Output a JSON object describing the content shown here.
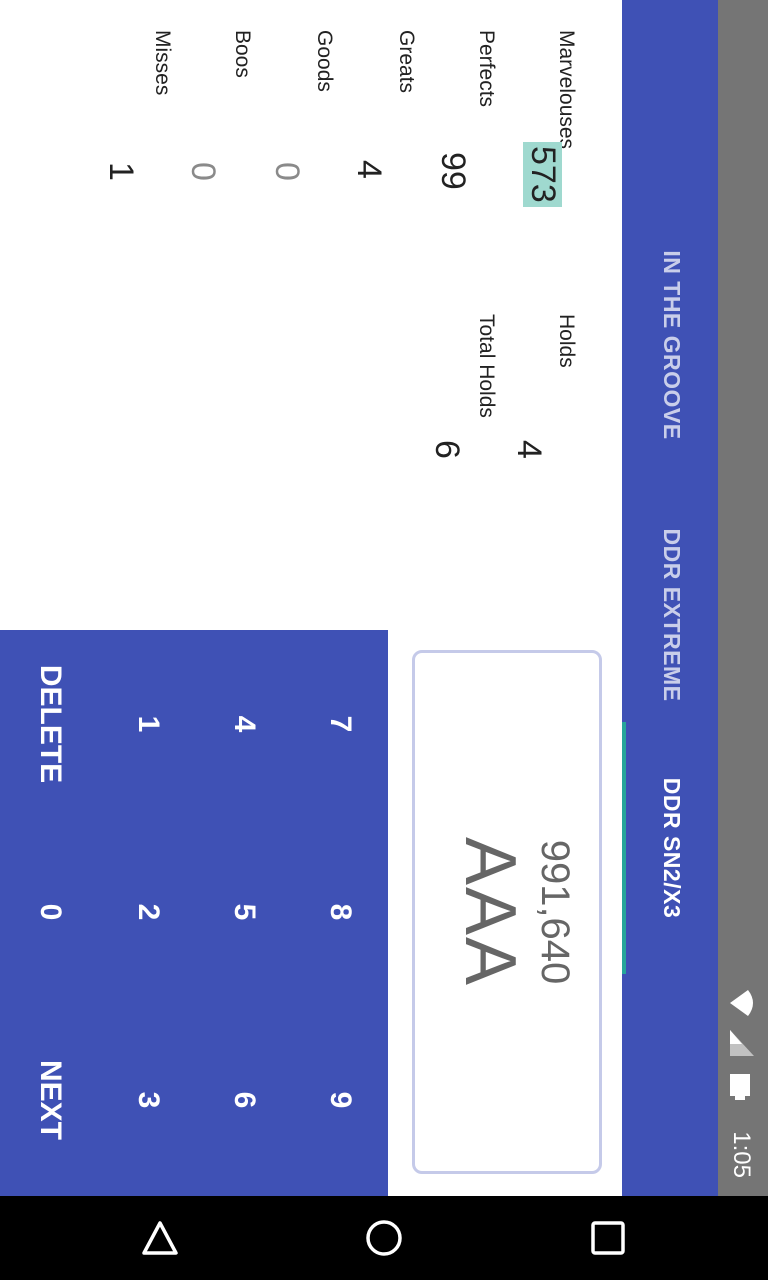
{
  "status_bar": {
    "time": "1:05",
    "icons": [
      "wifi-icon",
      "cell-signal-icon",
      "battery-icon"
    ]
  },
  "tabs": [
    {
      "label": "IN THE GROOVE",
      "active": false
    },
    {
      "label": "DDR EXTREME",
      "active": false
    },
    {
      "label": "DDR SN2/X3",
      "active": true
    }
  ],
  "colors": {
    "primary": "#3f51b5",
    "tab_indicator": "#26a69a",
    "highlight": "#9fd9cf",
    "status_bar": "#757575",
    "nav_bar": "#000000"
  },
  "judgments": [
    {
      "label": "Marvelouses",
      "value": "573",
      "highlighted": true
    },
    {
      "label": "Perfects",
      "value": "99"
    },
    {
      "label": "Greats",
      "value": "4"
    },
    {
      "label": "Goods",
      "value": "0"
    },
    {
      "label": "Boos",
      "value": "0"
    },
    {
      "label": "Misses",
      "value": "1"
    }
  ],
  "holds": [
    {
      "label": "Holds",
      "value": "4"
    },
    {
      "label": "Total Holds",
      "value": "6"
    }
  ],
  "score": {
    "value": "991,640",
    "grade": "AAA"
  },
  "keypad": {
    "rows": [
      [
        "7",
        "8",
        "9"
      ],
      [
        "4",
        "5",
        "6"
      ],
      [
        "1",
        "2",
        "3"
      ],
      [
        "DELETE",
        "0",
        "NEXT"
      ]
    ]
  },
  "nav_bar": {
    "buttons": [
      "back-icon",
      "home-icon",
      "recents-icon"
    ]
  }
}
